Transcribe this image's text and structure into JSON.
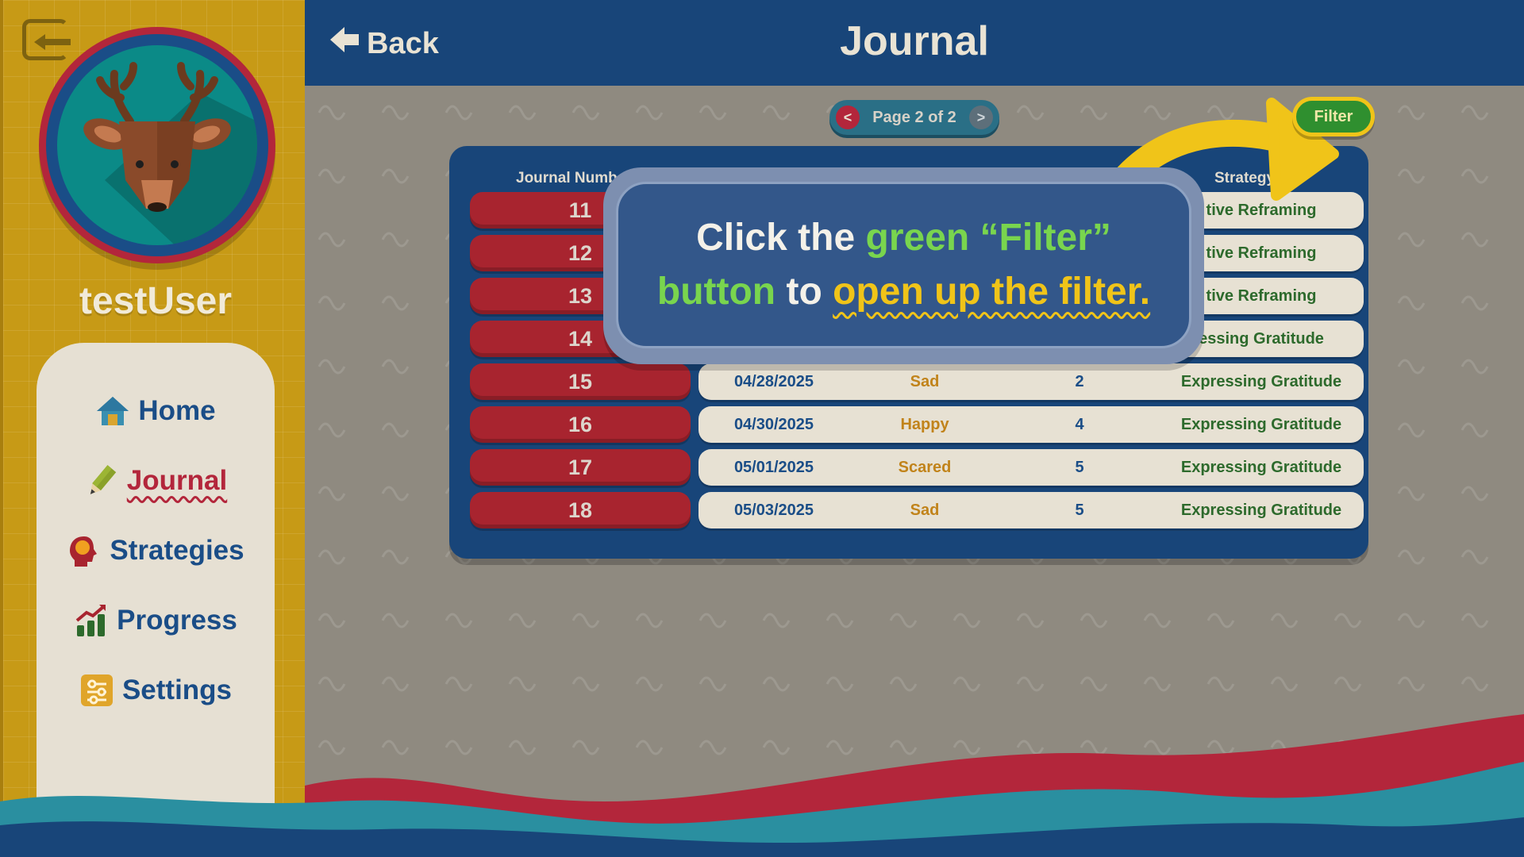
{
  "sidebar": {
    "username": "testUser",
    "nav": [
      {
        "label": "Home",
        "icon": "house-icon",
        "active": false
      },
      {
        "label": "Journal",
        "icon": "pencil-icon",
        "active": true
      },
      {
        "label": "Strategies",
        "icon": "brain-head-icon",
        "active": false
      },
      {
        "label": "Progress",
        "icon": "bar-chart-icon",
        "active": false
      },
      {
        "label": "Settings",
        "icon": "sliders-icon",
        "active": false
      }
    ],
    "avatar_icon": "deer-icon",
    "logout_icon": "logout-icon"
  },
  "header": {
    "back_label": "Back",
    "title": "Journal"
  },
  "pager": {
    "label": "Page 2 of 2",
    "prev": "<",
    "next": ">"
  },
  "filter": {
    "label": "Filter"
  },
  "table": {
    "headers": {
      "number": "Journal Numb",
      "strategy": "Strategy"
    },
    "rows": [
      {
        "number": "11",
        "date": "",
        "mood": "",
        "intensity": "",
        "strategy": "tive Reframing"
      },
      {
        "number": "12",
        "date": "",
        "mood": "",
        "intensity": "",
        "strategy": "tive Reframing"
      },
      {
        "number": "13",
        "date": "",
        "mood": "",
        "intensity": "",
        "strategy": "tive Reframing"
      },
      {
        "number": "14",
        "date": "",
        "mood": "",
        "intensity": "",
        "strategy": "essing Gratitude"
      },
      {
        "number": "15",
        "date": "04/28/2025",
        "mood": "Sad",
        "intensity": "2",
        "strategy": "Expressing Gratitude"
      },
      {
        "number": "16",
        "date": "04/30/2025",
        "mood": "Happy",
        "intensity": "4",
        "strategy": "Expressing Gratitude"
      },
      {
        "number": "17",
        "date": "05/01/2025",
        "mood": "Scared",
        "intensity": "5",
        "strategy": "Expressing Gratitude"
      },
      {
        "number": "18",
        "date": "05/03/2025",
        "mood": "Sad",
        "intensity": "5",
        "strategy": "Expressing Gratitude"
      }
    ]
  },
  "tooltip": {
    "part1": "Click the ",
    "part2": "green “Filter”",
    "part3": "button",
    "part4": " to ",
    "part5": "open up the filter."
  },
  "colors": {
    "header_bg": "#184579",
    "sidebar_bg": "#c79a16",
    "accent_red": "#a8242f",
    "filter_green": "#2f8f2f",
    "highlight_yellow": "#f0c419"
  }
}
